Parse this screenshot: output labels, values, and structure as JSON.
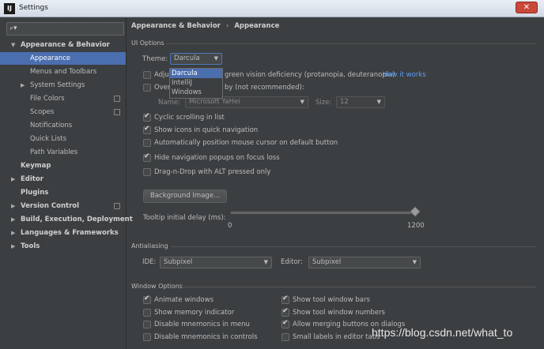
{
  "window": {
    "title": "Settings",
    "close_glyph": "✕"
  },
  "sidebar": {
    "search_icon": "search-icon",
    "items": [
      {
        "label": "Appearance & Behavior",
        "bold": true,
        "expanded": true
      },
      {
        "label": "Appearance",
        "selected": true
      },
      {
        "label": "Menus and Toolbars"
      },
      {
        "label": "System Settings"
      },
      {
        "label": "File Colors"
      },
      {
        "label": "Scopes"
      },
      {
        "label": "Notifications"
      },
      {
        "label": "Quick Lists"
      },
      {
        "label": "Path Variables"
      },
      {
        "label": "Keymap"
      },
      {
        "label": "Editor"
      },
      {
        "label": "Plugins"
      },
      {
        "label": "Version Control"
      },
      {
        "label": "Build, Execution, Deployment"
      },
      {
        "label": "Languages & Frameworks"
      },
      {
        "label": "Tools"
      }
    ]
  },
  "breadcrumb": {
    "parent": "Appearance & Behavior",
    "sep": "›",
    "current": "Appearance"
  },
  "ui_options": {
    "section": "UI Options",
    "theme_label": "Theme:",
    "theme_value": "Darcula",
    "theme_options": [
      "Darcula",
      "IntelliJ",
      "Windows"
    ],
    "adjust_prefix": "Adju",
    "adjust_suffix": "green vision deficiency (protanopia, deuteranopia)",
    "how_it_works": "How it works",
    "override_prefix": "Over",
    "override_suffix": "by (not recommended):",
    "font_name_label": "Name:",
    "font_name_value": "Microsoft YaHei",
    "font_size_label": "Size:",
    "font_size_value": "12",
    "cyclic_scrolling": "Cyclic scrolling in list",
    "show_icons": "Show icons in quick navigation",
    "auto_position": "Automatically position mouse cursor on default button",
    "hide_nav": "Hide navigation popups on focus loss",
    "drag_drop": "Drag-n-Drop with ALT pressed only",
    "background_image": "Background Image...",
    "tooltip_delay_label": "Tooltip initial delay (ms):",
    "tooltip_min": "0",
    "tooltip_max": "1200"
  },
  "antialiasing": {
    "section": "Antialiasing",
    "ide_label": "IDE:",
    "ide_value": "Subpixel",
    "editor_label": "Editor:",
    "editor_value": "Subpixel"
  },
  "window_options": {
    "section": "Window Options",
    "animate_windows": "Animate windows",
    "show_memory": "Show memory indicator",
    "disable_mnemonics_menu": "Disable mnemonics in menu",
    "disable_mnemonics_controls": "Disable mnemonics in controls",
    "show_tool_bars": "Show tool window bars",
    "show_tool_numbers": "Show tool window numbers",
    "allow_merging": "Allow merging buttons on dialogs",
    "small_labels": "Small labels in editor tabs"
  },
  "watermark": "https://blog.csdn.net/what_to",
  "colors": {
    "accent": "#4b6eaf",
    "link": "#589df6",
    "background": "#3c3f41"
  }
}
